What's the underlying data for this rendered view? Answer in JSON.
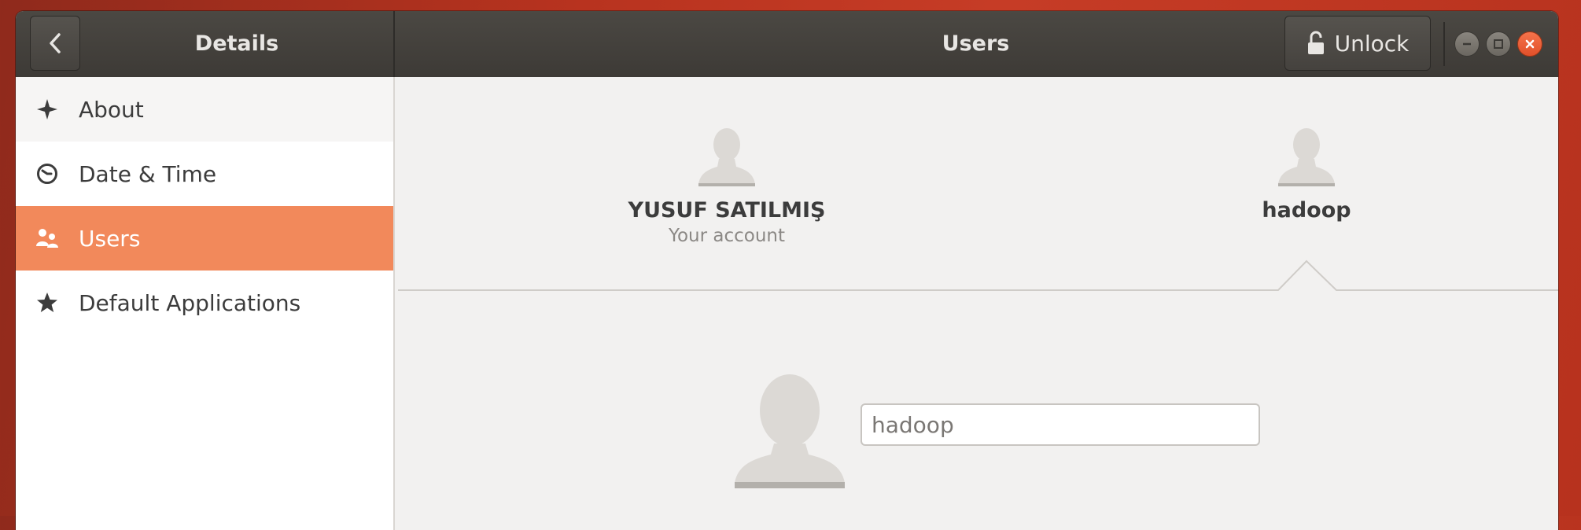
{
  "titlebar": {
    "left_title": "Details",
    "main_title": "Users",
    "unlock_label": "Unlock"
  },
  "sidebar": {
    "items": [
      {
        "label": "About",
        "icon": "sparkle-icon"
      },
      {
        "label": "Date & Time",
        "icon": "clock-icon"
      },
      {
        "label": "Users",
        "icon": "users-icon",
        "active": true
      },
      {
        "label": "Default Applications",
        "icon": "star-icon"
      }
    ]
  },
  "users": [
    {
      "name": "YUSUF SATILMIŞ",
      "subtitle": "Your account"
    },
    {
      "name": "hadoop",
      "selected": true
    }
  ],
  "detail": {
    "full_name_value": "hadoop"
  },
  "colors": {
    "accent": "#f2895b",
    "titlebar": "#423f3b",
    "close_button": "#e95420"
  }
}
